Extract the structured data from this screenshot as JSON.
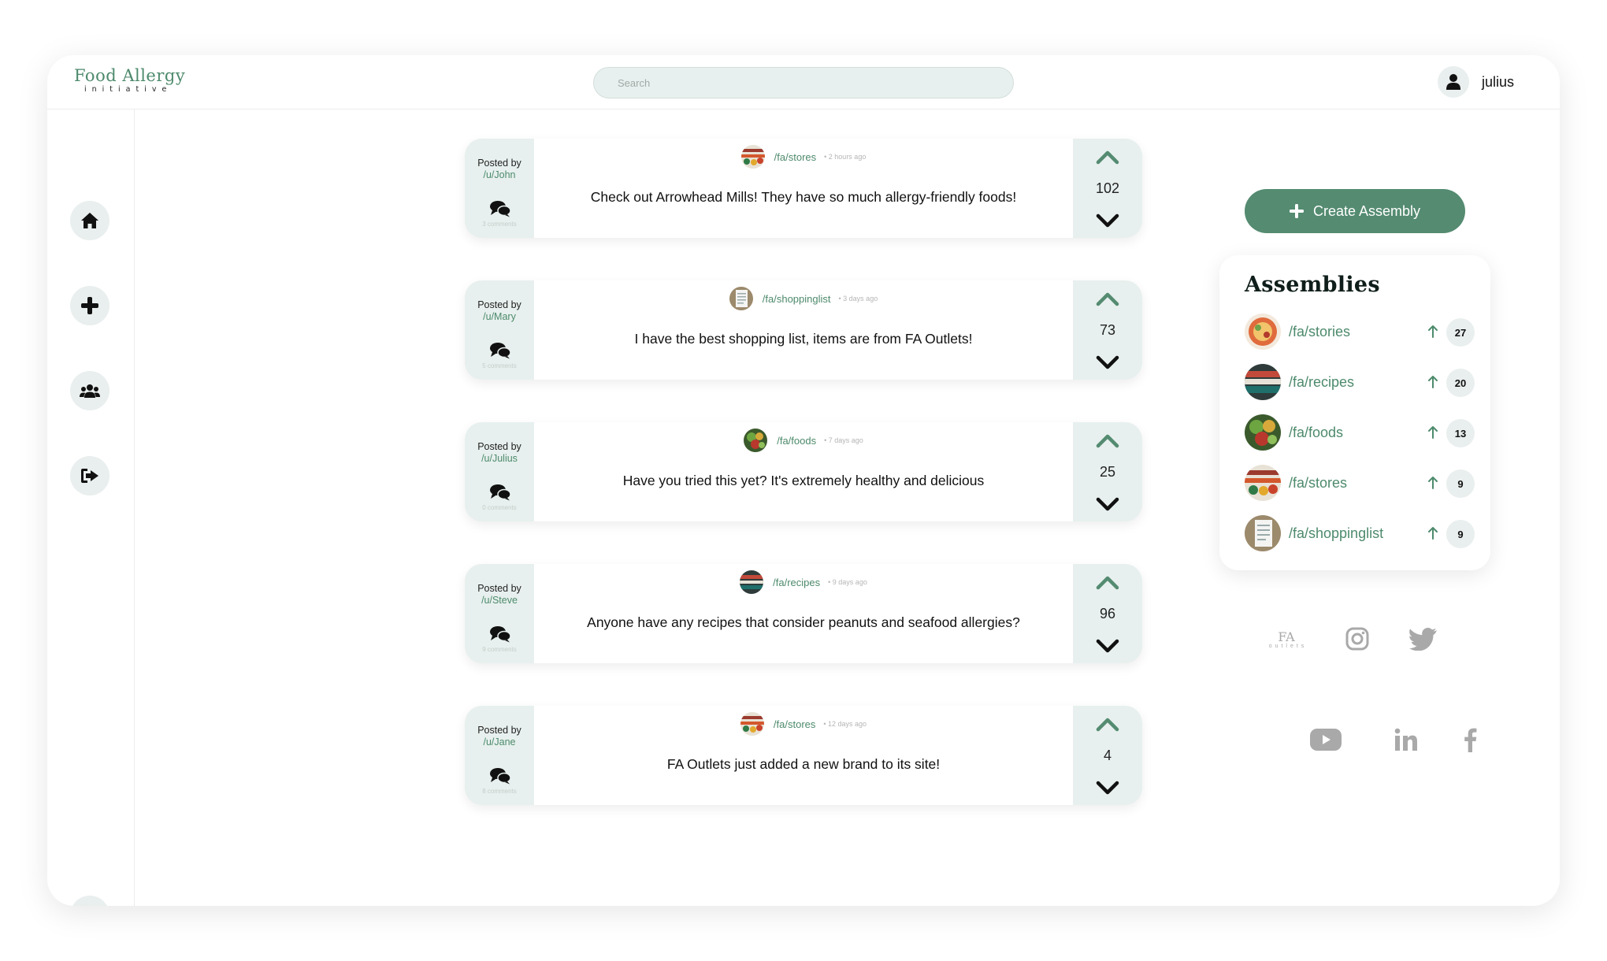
{
  "header": {
    "logo_top": "Food Allergy",
    "logo_bottom": "initiative",
    "search_placeholder": "Search",
    "username": "julius"
  },
  "sidebar": {
    "items": [
      {
        "icon": "home-icon"
      },
      {
        "icon": "plus-icon"
      },
      {
        "icon": "users-icon"
      },
      {
        "icon": "sign-out-icon"
      },
      {
        "icon": "id-card-icon"
      }
    ]
  },
  "posts": [
    {
      "posted_by": "Posted by",
      "author": "/u/John",
      "comments": "3 comments",
      "subreddit": "/fa/stores",
      "time": "• 2 hours ago",
      "title": "Check out Arrowhead Mills! They have so much allergy-friendly foods!",
      "score": "102"
    },
    {
      "posted_by": "Posted by",
      "author": "/u/Mary",
      "comments": "5 comments",
      "subreddit": "/fa/shoppinglist",
      "time": "• 3 days ago",
      "title": "I have the best shopping list, items are from FA Outlets!",
      "score": "73"
    },
    {
      "posted_by": "Posted by",
      "author": "/u/Julius",
      "comments": "0 comments",
      "subreddit": "/fa/foods",
      "time": "• 7 days ago",
      "title": "Have you tried this yet? It's extremely healthy and delicious",
      "score": "25"
    },
    {
      "posted_by": "Posted by",
      "author": "/u/Steve",
      "comments": "9 comments",
      "subreddit": "/fa/recipes",
      "time": "• 9 days ago",
      "title": "Anyone have any recipes that consider peanuts and seafood allergies?",
      "score": "96"
    },
    {
      "posted_by": "Posted by",
      "author": "/u/Jane",
      "comments": "8 comments",
      "subreddit": "/fa/stores",
      "time": "• 12 days ago",
      "title": "FA Outlets just added a new brand to its site!",
      "score": "4"
    }
  ],
  "create_button": "Create Assembly",
  "assemblies": {
    "heading": "Assemblies",
    "items": [
      {
        "name": "/fa/stories",
        "count": "27"
      },
      {
        "name": "/fa/recipes",
        "count": "20"
      },
      {
        "name": "/fa/foods",
        "count": "13"
      },
      {
        "name": "/fa/stores",
        "count": "9"
      },
      {
        "name": "/fa/shoppinglist",
        "count": "9"
      }
    ]
  },
  "footer": {
    "fa_outlets_top": "FA",
    "fa_outlets_bottom": "outlets",
    "socials": [
      "instagram-icon",
      "twitter-icon",
      "youtube-icon",
      "linkedin-icon",
      "facebook-icon"
    ]
  },
  "colors": {
    "accent": "#548b71",
    "accent_text": "#4d8a6c",
    "soft_bg": "#e7f0ee"
  }
}
